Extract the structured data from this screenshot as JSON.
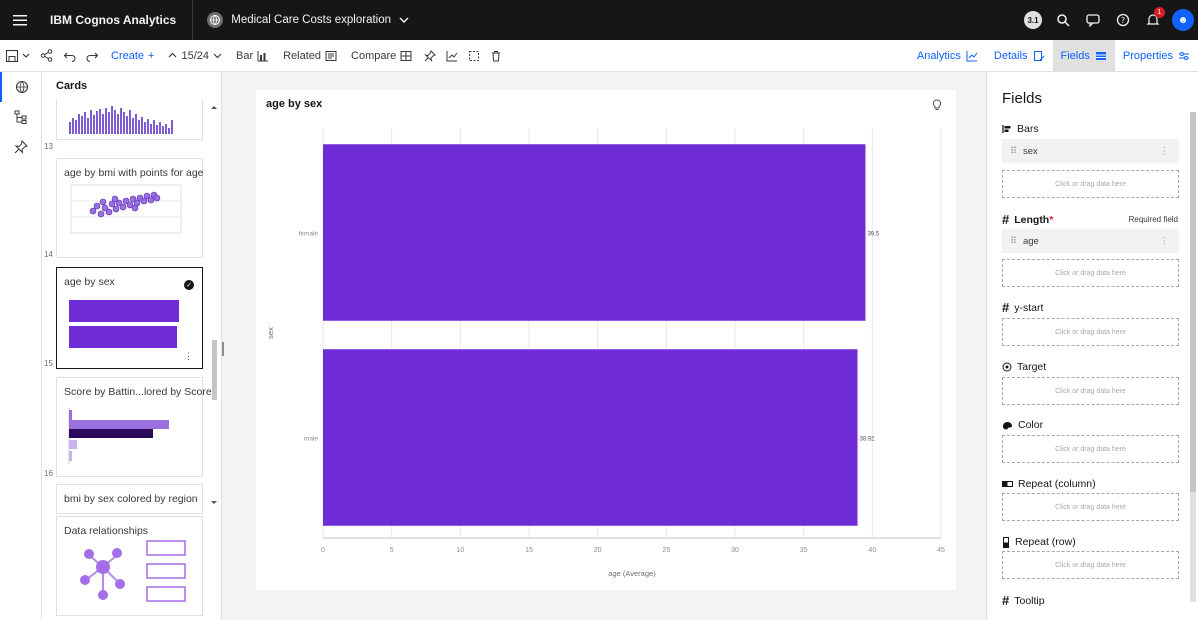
{
  "topbar": {
    "app_name": "IBM Cognos Analytics",
    "doc_title": "Medical Care Costs exploration",
    "user_badge": "3.1",
    "notification_count": "1"
  },
  "toolbar": {
    "create_label": "Create",
    "page_counter": "15/24",
    "bar_label": "Bar",
    "related_label": "Related",
    "compare_label": "Compare",
    "analytics_label": "Analytics",
    "details_label": "Details",
    "fields_label": "Fields",
    "properties_label": "Properties"
  },
  "cards_panel": {
    "title": "Cards",
    "cards": [
      {
        "num": "13",
        "title": ""
      },
      {
        "num": "14",
        "title": "age by bmi with points for age"
      },
      {
        "num": "15",
        "title": "age by sex",
        "selected": true
      },
      {
        "num": "16",
        "title": "Score by Battin...lored by Score"
      },
      {
        "num": "",
        "title": "bmi by sex colored by region"
      },
      {
        "num": "",
        "title": "Data relationships"
      }
    ]
  },
  "chart": {
    "title": "age by sex",
    "bar_color": "#6f2bd6",
    "ylabel": "sex",
    "xlabel": "age (Average)"
  },
  "chart_data": {
    "type": "bar",
    "orientation": "horizontal",
    "title": "age by sex",
    "categories": [
      "female",
      "male"
    ],
    "values": [
      39.5,
      38.92
    ],
    "value_labels": [
      "39.5",
      "38.92"
    ],
    "xlabel": "age (Average)",
    "ylabel": "sex",
    "xlim": [
      0,
      45
    ],
    "xticks": [
      "0",
      "5",
      "10",
      "15",
      "20",
      "25",
      "30",
      "35",
      "40",
      "45"
    ],
    "grid": true
  },
  "fields_panel": {
    "title": "Fields",
    "bars_label": "Bars",
    "bars_value": "sex",
    "length_label": "Length",
    "required_asterisk": "*",
    "required_note": "Required field",
    "length_value": "age",
    "ystart_label": "y-start",
    "target_label": "Target",
    "color_label": "Color",
    "repeat_col_label": "Repeat (column)",
    "repeat_row_label": "Repeat (row)",
    "tooltip_label": "Tooltip",
    "drop_hint": "Click or drag data here"
  }
}
